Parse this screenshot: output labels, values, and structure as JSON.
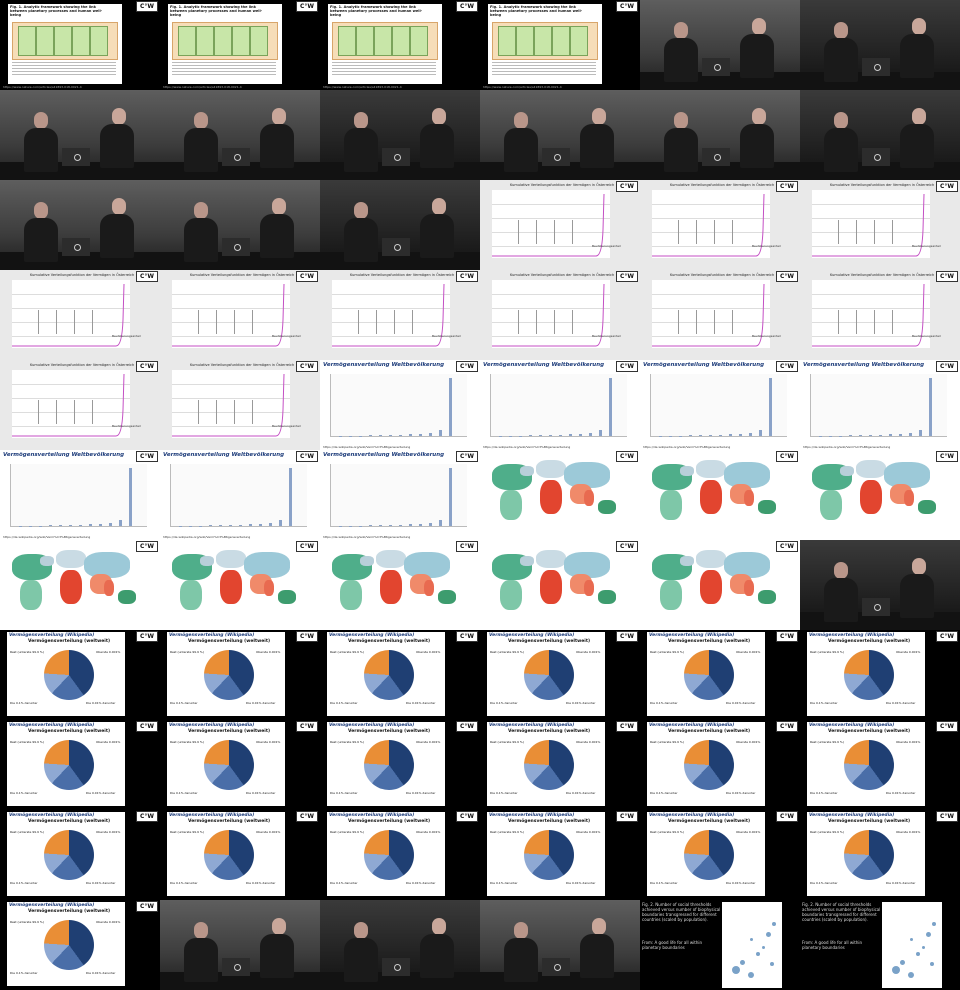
{
  "sheet": {
    "columns": 6,
    "rows": 11,
    "cells": [
      "framework",
      "framework",
      "framework",
      "framework",
      "talk",
      "talk",
      "talk",
      "talk",
      "talk",
      "talk",
      "talk",
      "talk",
      "talk",
      "talk",
      "talk",
      "linechart",
      "linechart",
      "linechart",
      "linechart",
      "linechart",
      "linechart",
      "linechart",
      "linechart",
      "linechart",
      "linechart",
      "linechart",
      "barchart",
      "barchart",
      "barchart",
      "barchart",
      "barchart",
      "barchart",
      "barchart",
      "map",
      "map",
      "map",
      "map",
      "map",
      "map",
      "map",
      "map",
      "talk",
      "pie",
      "pie",
      "pie",
      "pie",
      "pie",
      "pie",
      "pie",
      "pie",
      "pie",
      "pie",
      "pie",
      "pie",
      "pie",
      "pie",
      "pie",
      "pie",
      "pie",
      "pie",
      "pie",
      "talk",
      "talk",
      "talk",
      "scatter",
      "scatter"
    ]
  },
  "logo_text": "C°W",
  "framework": {
    "title": "Fig. 1. Analytic framework showing the link between planetary processes and human well-being",
    "url": "https://www.nature.com/articles/s41893-018-0021-4"
  },
  "linechart": {
    "title": "Kumulative Verteilungsfunktion der Vermögen in Österreich",
    "marker": "Bevölkerungsanteil"
  },
  "barchart": {
    "title": "Vermögensverteilung Weltbevölkerung",
    "url": "https://de.wikipedia.org/wiki/Verm%C3%B6gensverteilung"
  },
  "pie": {
    "title": "Vermögensverteilung (Wikipedia)",
    "subtitle": "Vermögensverteilung (weltweit)",
    "labels": [
      "Rest (unterste 99.9 %)",
      "Oberste 0.001%",
      "Die 0.1% darunter",
      "Die 0.01% darunter"
    ],
    "slices": [
      40,
      22,
      14,
      24
    ],
    "colors": [
      "#1f3f73",
      "#4a6ea8",
      "#8fa9d3",
      "#e98e36"
    ]
  },
  "scatter": {
    "caption": "Fig. 2. Number of social thresholds achieved versus number of biophysical boundaries transgressed for different countries (scaled by population).",
    "caption2": "From: A good life for all within planetary boundaries"
  }
}
